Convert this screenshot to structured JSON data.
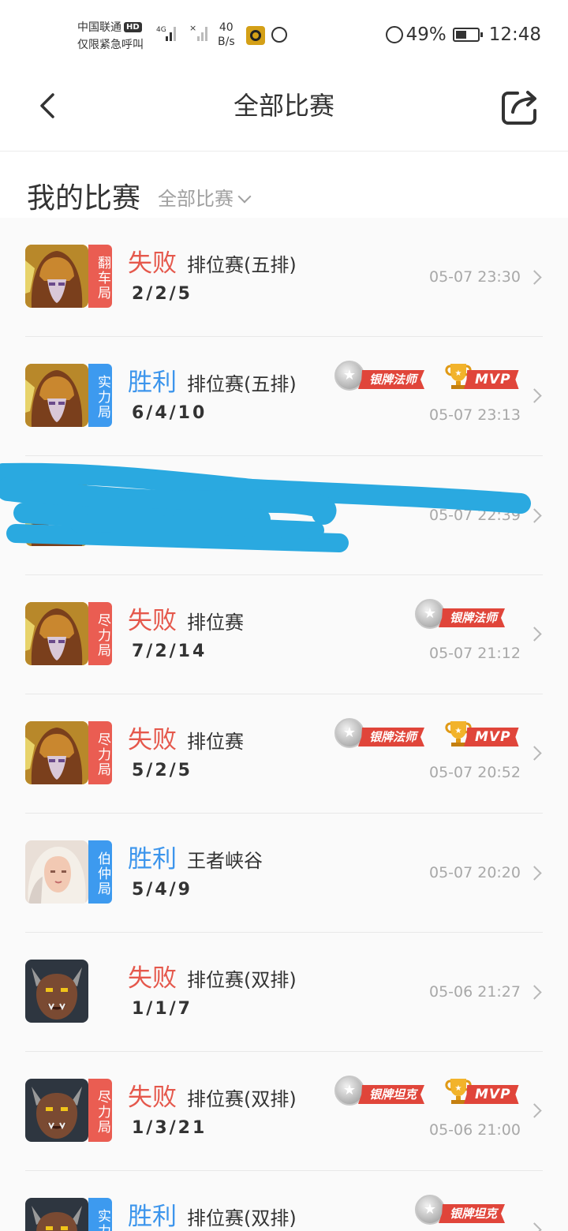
{
  "status_bar": {
    "carrier_line1": "中国联通",
    "hd": "HD",
    "carrier_line2": "仅限紧急呼叫",
    "net_speed_value": "40",
    "net_speed_unit": "B/s",
    "battery": "49%",
    "time": "12:48"
  },
  "nav": {
    "title": "全部比赛"
  },
  "section": {
    "title": "我的比赛",
    "filter": "全部比赛"
  },
  "matches": [
    {
      "tag": "翻车局",
      "tag_color": "red",
      "result": "失败",
      "result_type": "lose",
      "mode": "排位赛(五排)",
      "kda": "2/2/5",
      "time": "05-07 23:30",
      "badges": [],
      "avatar": "hero-helmet"
    },
    {
      "tag": "实力局",
      "tag_color": "blue",
      "result": "胜利",
      "result_type": "win",
      "mode": "排位赛(五排)",
      "kda": "6/4/10",
      "time": "05-07 23:13",
      "badges": [
        "银牌法师",
        "MVP"
      ],
      "avatar": "hero-helmet"
    },
    {
      "tag": "",
      "tag_color": "",
      "result": "",
      "result_type": "",
      "mode": "",
      "kda": "",
      "time": "05-07 22:39",
      "badges": [],
      "avatar": "hero-helmet",
      "obscured": true
    },
    {
      "tag": "尽力局",
      "tag_color": "red",
      "result": "失败",
      "result_type": "lose",
      "mode": "排位赛",
      "kda": "7/2/14",
      "time": "05-07 21:12",
      "badges": [
        "银牌法师"
      ],
      "avatar": "hero-helmet"
    },
    {
      "tag": "尽力局",
      "tag_color": "red",
      "result": "失败",
      "result_type": "lose",
      "mode": "排位赛",
      "kda": "5/2/5",
      "time": "05-07 20:52",
      "badges": [
        "银牌法师",
        "MVP"
      ],
      "avatar": "hero-helmet"
    },
    {
      "tag": "伯仲局",
      "tag_color": "blue",
      "result": "胜利",
      "result_type": "win",
      "mode": "王者峡谷",
      "kda": "5/4/9",
      "time": "05-07 20:20",
      "badges": [],
      "avatar": "hero-lady"
    },
    {
      "tag": "",
      "tag_color": "",
      "result": "失败",
      "result_type": "lose",
      "mode": "排位赛(双排)",
      "kda": "1/1/7",
      "time": "05-06 21:27",
      "badges": [],
      "avatar": "hero-beast"
    },
    {
      "tag": "尽力局",
      "tag_color": "red",
      "result": "失败",
      "result_type": "lose",
      "mode": "排位赛(双排)",
      "kda": "1/3/21",
      "time": "05-06 21:00",
      "badges": [
        "银牌坦克",
        "MVP"
      ],
      "avatar": "hero-beast"
    },
    {
      "tag": "实力局",
      "tag_color": "blue",
      "result": "胜利",
      "result_type": "win",
      "mode": "排位赛(双排)",
      "kda": "",
      "time": "",
      "badges": [
        "银牌坦克"
      ],
      "avatar": "hero-beast"
    }
  ]
}
